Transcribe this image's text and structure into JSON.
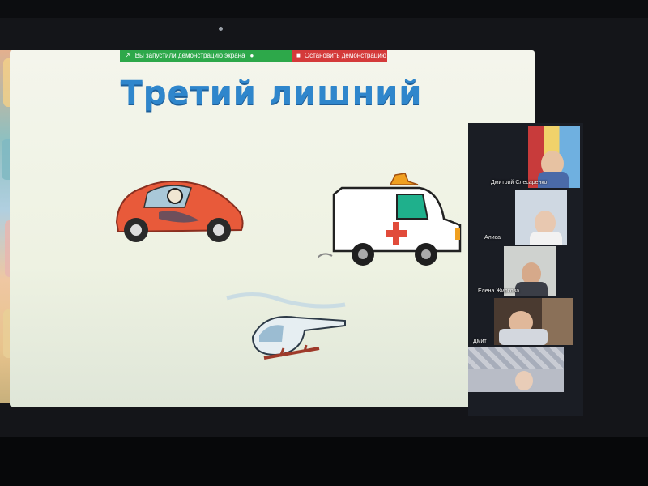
{
  "screen_share": {
    "status_text": "Вы запустили демонстрацию экрана",
    "stop_label": "Остановить демонстрацию",
    "status_color": "#2da84a",
    "stop_color": "#d43a3a"
  },
  "slide": {
    "title": "Третий лишний",
    "title_color": "#2f86cc",
    "images": [
      "beetle-car",
      "ambulance-van",
      "helicopter"
    ]
  },
  "participants": [
    {
      "name": "Дмитрий Слесаренко"
    },
    {
      "name": "Алиса"
    },
    {
      "name": "Елена Жиркова"
    },
    {
      "name": "Дмит"
    },
    {
      "name": ""
    }
  ]
}
